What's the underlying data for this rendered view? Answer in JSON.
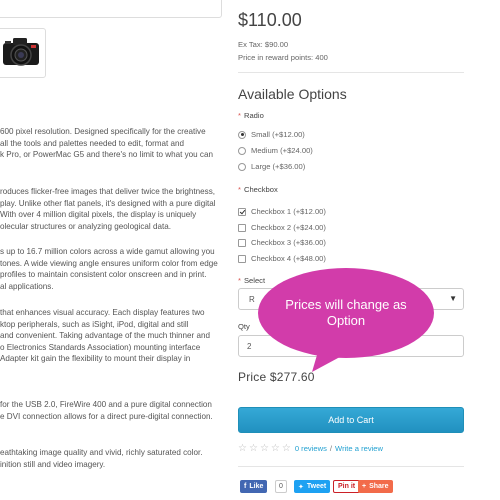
{
  "product": {
    "price": "$110.00",
    "ex_tax": "Ex Tax: $90.00",
    "reward_points": "Price in reward points: 400"
  },
  "description": {
    "paragraphs": [
      [
        "600 pixel resolution. Designed specifically for the creative",
        "all the tools and palettes needed to edit, format and",
        "k Pro, or PowerMac G5 and there's no limit to what you can"
      ],
      [
        "roduces flicker-free images that deliver twice the brightness,",
        "play. Unlike other flat panels, it's designed with a pure digital",
        "With over 4 million digital pixels, the display is uniquely",
        "olecular structures or analyzing geological data."
      ],
      [
        "s up to 16.7 million colors across a wide gamut allowing you",
        "tones. A wide viewing angle ensures uniform color from edge",
        "profiles to maintain consistent color onscreen and in print.",
        "al applications."
      ],
      [
        "that enhances visual accuracy. Each display features two",
        "ktop peripherals, such as iSight, iPod, digital and still",
        "and convenient. Taking advantage of the much thinner and",
        "o Electronics Standards Association) mounting interface",
        "Adapter kit gain the flexibility to mount their display in"
      ],
      [
        "for the USB 2.0, FireWire 400 and a pure digital connection",
        "e DVI connection allows for a direct pure-digital connection."
      ],
      [
        "eathtaking image quality and vivid, richly saturated color.",
        "inition still and video imagery."
      ]
    ]
  },
  "options": {
    "heading": "Available Options",
    "radio": {
      "label": "Radio",
      "items": [
        "Small (+$12.00)",
        "Medium (+$24.00)",
        "Large (+$36.00)"
      ],
      "selected": 0
    },
    "checkbox": {
      "label": "Checkbox",
      "items": [
        "Checkbox 1 (+$12.00)",
        "Checkbox 2 (+$24.00)",
        "Checkbox 3 (+$36.00)",
        "Checkbox 4 (+$48.00)"
      ],
      "checked": [
        true,
        false,
        false,
        false
      ]
    },
    "select": {
      "label": "Select",
      "value": "R"
    }
  },
  "qty": {
    "label": "Qty",
    "value": "2"
  },
  "total_price": "Price $277.60",
  "add_to_cart": "Add to Cart",
  "reviews": {
    "reviews_link": "0 reviews",
    "separator": "/",
    "write_link": "Write a review"
  },
  "share": {
    "like": "Like",
    "like_count": "0",
    "tweet": "Tweet",
    "pin": "Pin it",
    "share": "Share"
  },
  "callout": {
    "text": "Prices will change as Option"
  },
  "colors": {
    "accent": "#23a1d1",
    "button": "#2191c0",
    "callout": "#d23caa",
    "required": "#d9534f"
  }
}
